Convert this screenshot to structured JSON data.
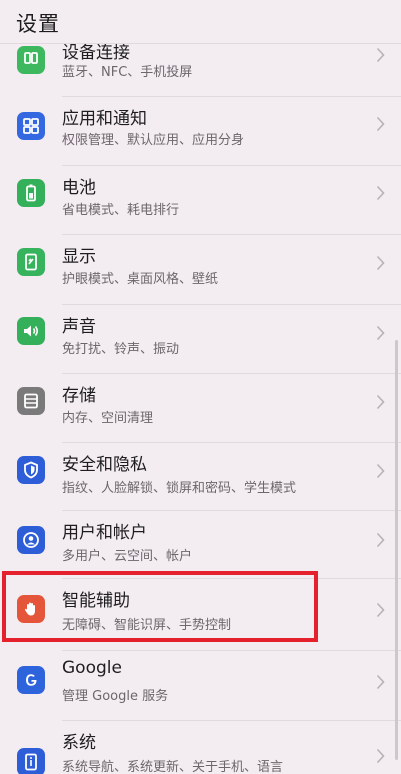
{
  "header": {
    "title": "设置"
  },
  "items": [
    {
      "key": "connect",
      "title": "设备连接",
      "subtitle": "蓝牙、NFC、手机投屏",
      "icon": "device-connect-icon",
      "color": "#3db85f"
    },
    {
      "key": "apps",
      "title": "应用和通知",
      "subtitle": "权限管理、默认应用、应用分身",
      "icon": "apps-grid-icon",
      "color": "#3468e0"
    },
    {
      "key": "battery",
      "title": "电池",
      "subtitle": "省电模式、耗电排行",
      "icon": "battery-icon",
      "color": "#34b05a"
    },
    {
      "key": "display",
      "title": "显示",
      "subtitle": "护眼模式、桌面风格、壁纸",
      "icon": "display-icon",
      "color": "#36b35c"
    },
    {
      "key": "sound",
      "title": "声音",
      "subtitle": "免打扰、铃声、振动",
      "icon": "speaker-icon",
      "color": "#34b05a"
    },
    {
      "key": "storage",
      "title": "存储",
      "subtitle": "内存、空间清理",
      "icon": "storage-icon",
      "color": "#7a7a7a"
    },
    {
      "key": "security",
      "title": "安全和隐私",
      "subtitle": "指纹、人脸解锁、锁屏和密码、学生模式",
      "icon": "shield-icon",
      "color": "#2d5ed8"
    },
    {
      "key": "users",
      "title": "用户和帐户",
      "subtitle": "多用户、云空间、帐户",
      "icon": "user-icon",
      "color": "#2d5ed8"
    },
    {
      "key": "assist",
      "title": "智能辅助",
      "subtitle": "无障碍、智能识屏、手势控制",
      "icon": "hand-icon",
      "color": "#e4553a"
    },
    {
      "key": "google",
      "title": "Google",
      "subtitle": "管理 Google 服务",
      "icon": "google-icon",
      "color": "#2d64dc"
    },
    {
      "key": "system",
      "title": "系统",
      "subtitle": "系统导航、系统更新、关于手机、语言",
      "icon": "phone-info-icon",
      "color": "#2d5ed8"
    }
  ]
}
